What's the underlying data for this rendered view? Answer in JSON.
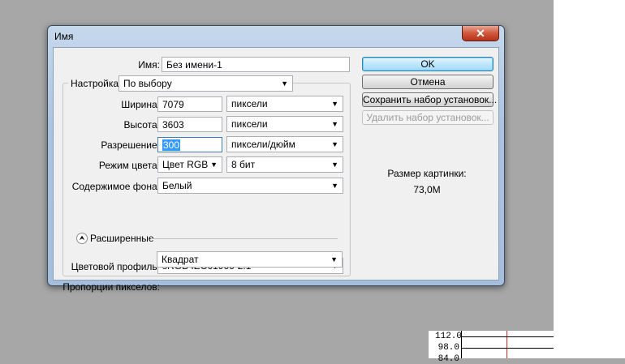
{
  "dialog": {
    "title": "Имя",
    "name_label": "Имя:",
    "name_value": "Без имени-1",
    "preset_label": "Настройка:",
    "preset_value": "По выбору",
    "width_label": "Ширина:",
    "width_value": "7079",
    "width_unit": "пиксели",
    "height_label": "Высота:",
    "height_value": "3603",
    "height_unit": "пиксели",
    "resolution_label": "Разрешение:",
    "resolution_value": "300",
    "resolution_unit": "пиксели/дюйм",
    "color_mode_label": "Режим цвета:",
    "color_mode_value": "Цвет RGB",
    "bit_depth_value": "8 бит",
    "background_label": "Содержимое фона:",
    "background_value": "Белый",
    "advanced_label": "Расширенные",
    "color_profile_label": "Цветовой профиль:",
    "color_profile_value": "sRGB IEC61966-2.1",
    "pixel_aspect_label": "Пропорции пикселов:",
    "pixel_aspect_value": "Квадрат"
  },
  "buttons": {
    "ok": "OK",
    "cancel": "Отмена",
    "save_preset": "Сохранить набор установок...",
    "delete_preset": "Удалить набор установок..."
  },
  "image_size": {
    "label": "Размер картинки:",
    "value": "73,0M"
  },
  "ruler": {
    "ticks": [
      "112.0",
      "98.0",
      "84.0"
    ]
  },
  "icons": {
    "close": "close-icon",
    "dropdown": "chevron-down-icon",
    "expand": "collapse-chevron-icon"
  },
  "colors": {
    "selection": "#3399ff",
    "close_button": "#c7452b",
    "ruler_marker": "#dd2222"
  }
}
